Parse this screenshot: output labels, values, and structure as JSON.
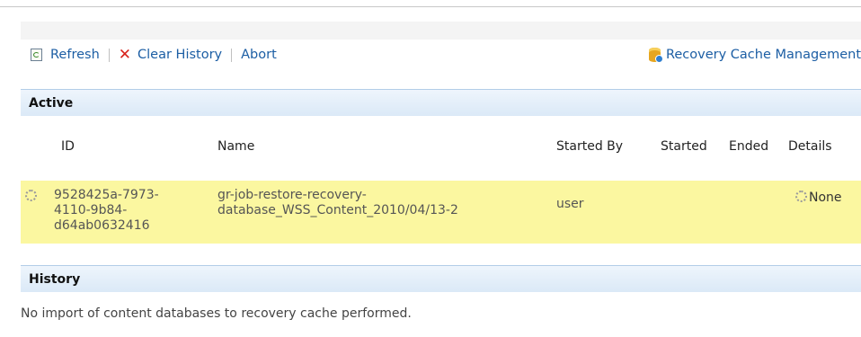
{
  "toolbar": {
    "refresh_label": "Refresh",
    "clear_history_label": "Clear History",
    "abort_label": "Abort",
    "recovery_cache_label": "Recovery Cache Management"
  },
  "active": {
    "title": "Active",
    "columns": {
      "id": "ID",
      "name": "Name",
      "started_by": "Started By",
      "started": "Started",
      "ended": "Ended",
      "details": "Details"
    },
    "rows": [
      {
        "id_lines": [
          "9528425a-7973-",
          "4110-9b84-",
          "d64ab0632416"
        ],
        "name_lines": [
          "gr-job-restore-recovery-",
          "database_WSS_Content_2010/04/13-2"
        ],
        "started_by": "user",
        "started": "",
        "ended": "",
        "details": "None"
      }
    ]
  },
  "history": {
    "title": "History",
    "empty_message": "No import of content databases to recovery cache performed."
  },
  "colors": {
    "link": "#1c5ea4",
    "section_header": "#dbe9f7",
    "active_row": "#fbf7a0",
    "clear_icon": "#d8231c"
  },
  "icons": [
    "refresh-icon",
    "clear-icon",
    "recovery-cache-icon",
    "spinner-icon"
  ]
}
